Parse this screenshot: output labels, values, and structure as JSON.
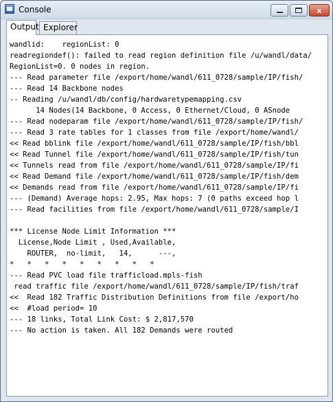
{
  "window": {
    "title": "Console",
    "minimize_label": "",
    "maximize_label": "",
    "close_label": "x"
  },
  "tabs": [
    {
      "label": "Output",
      "active": true
    },
    {
      "label": "Explorer",
      "active": false
    }
  ],
  "console": {
    "lines": [
      "wandlid:    regionList: 0",
      "readregiondef(): failed to read region definition file /u/wandl/data/",
      "RegionList=0. 0 nodes in region.",
      "--- Read parameter file /export/home/wandl/611_0728/sample/IP/fish/",
      "--- Read 14 Backbone nodes",
      "-- Reading /u/wandl/db/config/hardwaretypemapping.csv",
      "      14 Nodes(14 Backbone, 0 Access, 0 Ethernet/Cloud, 0 ASnode",
      "--- Read nodeparam file /export/home/wandl/611_0728/sample/IP/fish/",
      "--- Read 3 rate tables for 1 classes from file /export/home/wandl/",
      "<< Read bblink file /export/home/wandl/611_0728/sample/IP/fish/bbl",
      "<< Read Tunnel file /export/home/wandl/611_0728/sample/IP/fish/tun",
      "<< Tunnels read from file /export/home/wandl/611_0728/sample/IP/fi",
      "<< Read Demand file /export/home/wandl/611_0728/sample/IP/fish/dem",
      "<< Demands read from file /export/home/wandl/611_0728/sample/IP/fi",
      "--- (Demand) Average hops: 2.95, Max hops: 7 (0 paths exceed hop l",
      "--- Read facilities from file /export/home/wandl/611_0728/sample/I",
      "",
      "*** License Node Limit Information ***",
      "  License,Node Limit , Used,Available,",
      "    ROUTER,  no-limit,   14,      ---,",
      "*   *   *   *   *   *   *   *   *",
      "--- Read PVC load file trafficload.mpls-fish",
      " read traffic file /export/home/wandl/611_0728/sample/IP/fish/traf",
      "<<  Read 182 Traffic Distribution Definitions from file /export/ho",
      "<<  #load period= 10",
      "--- 18 links, Total Link Cost: $ 2,817,570",
      "--- No action is taken. All 182 Demands were routed"
    ]
  }
}
